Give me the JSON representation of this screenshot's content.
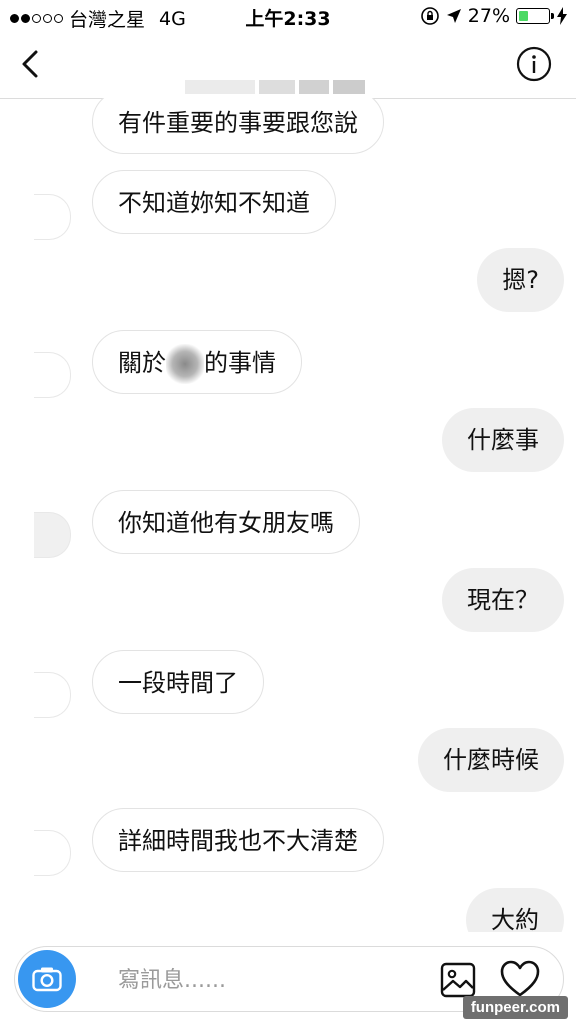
{
  "status_bar": {
    "carrier": "台灣之星",
    "network": "4G",
    "time": "上午2:33",
    "battery_percent": "27%",
    "battery_level": 0.27,
    "battery_color": "#4cd964"
  },
  "header": {
    "back_icon": "chevron-left-icon",
    "info_icon": "info-circle-icon"
  },
  "messages": [
    {
      "side": "in",
      "text": "有件重要的事要跟您說"
    },
    {
      "side": "in",
      "text": "不知道妳知不知道"
    },
    {
      "side": "out",
      "text": "摁?"
    },
    {
      "side": "in",
      "text_before": "關於",
      "text_after": "的事情"
    },
    {
      "side": "out",
      "text": "什麼事"
    },
    {
      "side": "in",
      "text": "你知道他有女朋友嗎"
    },
    {
      "side": "out",
      "text": "現在？"
    },
    {
      "side": "in",
      "text": "一段時間了"
    },
    {
      "side": "out",
      "text": "什麼時候"
    },
    {
      "side": "in",
      "text": "詳細時間我也不大清楚"
    },
    {
      "side": "out",
      "text": "大約"
    }
  ],
  "composer": {
    "placeholder": "寫訊息......",
    "camera_icon": "camera-icon",
    "gallery_icon": "image-icon",
    "like_icon": "heart-icon",
    "accent_color": "#3897f0"
  },
  "watermark": "funpeer.com"
}
